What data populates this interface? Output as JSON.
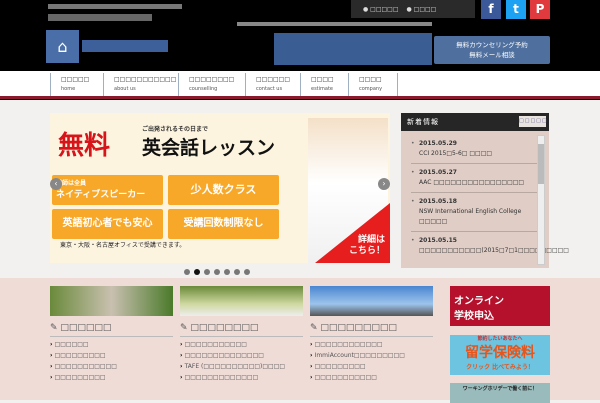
{
  "header": {
    "logo_icon": "opera-house-icon",
    "top_links": [
      "□□□□□",
      "□□□□"
    ],
    "sns": [
      {
        "name": "facebook",
        "label": "f",
        "color": "#3b5998"
      },
      {
        "name": "twitter",
        "label": "t",
        "color": "#1da1f2"
      },
      {
        "name": "pinterest",
        "label": "P",
        "color": "#e0393e"
      }
    ],
    "consult_button": [
      "無料カウンセリング予約",
      "無料メール相談"
    ]
  },
  "nav": [
    {
      "ja": "□□□□□",
      "en": "home"
    },
    {
      "ja": "□□□□□□□□□□□",
      "en": "about us"
    },
    {
      "ja": "□□□□□□□□",
      "en": "counselling"
    },
    {
      "ja": "□□□□□□",
      "en": "contact us"
    },
    {
      "ja": "□□□□",
      "en": "estimate"
    },
    {
      "ja": "□□□□",
      "en": "company"
    }
  ],
  "banner": {
    "free": "無料",
    "subtitle": "ご出発されるその日まで",
    "title": "英会話レッスン",
    "chips": [
      {
        "small": "講師は全員",
        "big": "ネイティブスピーカー"
      },
      {
        "big": "少人数クラス"
      },
      {
        "big": "英語初心者でも安心"
      },
      {
        "big": "受講回数制限なし"
      }
    ],
    "note": "東京・大阪・名古屋オフィスで受講できます。",
    "detail": [
      "詳細は",
      "こちら！"
    ],
    "slides": 7,
    "active_slide": 2
  },
  "news": {
    "title": "新着情報",
    "more": "□□□□□",
    "items": [
      {
        "date": "2015.05.29",
        "text": "CCI 2015□5-6□ □□□□"
      },
      {
        "date": "2015.05.27",
        "text": "AAC □□□□□□□□□□□□□□□□"
      },
      {
        "date": "2015.05.18",
        "text": "NSW International English College □□□□□"
      },
      {
        "date": "2015.05.15",
        "text": "□□□□□□□□□□□(2015□7□1□□□□□□□□□"
      }
    ]
  },
  "columns": [
    {
      "title": "□□□□□□",
      "items": [
        "□□□□□□",
        "□□□□□□□□□",
        "□□□□□□□□□□□",
        "□□□□□□□□□"
      ]
    },
    {
      "title": "□□□□□□□□",
      "items": [
        "□□□□□□□□□□□",
        "□□□□□□□□□□□□□□",
        "TAFE (□□□□□□□□□□)□□□□",
        "□□□□□□□□□□□□□"
      ]
    },
    {
      "title": "□□□□□□□□□",
      "items": [
        "□□□□□□□□□□□□",
        "ImmiAccount□□□□□□□□□",
        "□□□□□□□□□",
        "□□□□□□□□□□□"
      ]
    }
  ],
  "ads": [
    {
      "text": "オンライン学校申込",
      "color": "#b5102c"
    },
    {
      "top": "節約したいあなたへ",
      "text": "留学保険料",
      "bottom": "クリック 比べてみよう！",
      "color": "#6cc4e0"
    },
    {
      "text": "ワーキングホリデーで働く前に！",
      "color": "#9bb"
    }
  ]
}
